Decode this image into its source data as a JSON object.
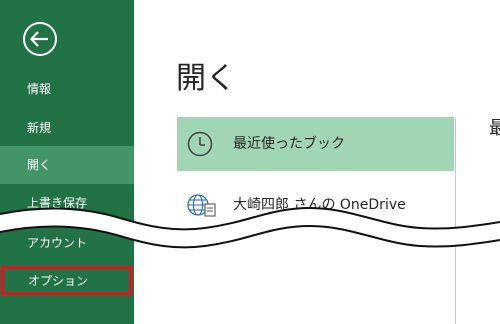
{
  "sidebar": {
    "items": [
      {
        "label": "情報"
      },
      {
        "label": "新規"
      },
      {
        "label": "開く"
      },
      {
        "label": "上書き保存"
      },
      {
        "label": "アカウント"
      },
      {
        "label": "オプション"
      }
    ]
  },
  "main": {
    "title": "開く",
    "locations": [
      {
        "label": "最近使ったブック",
        "icon": "clock-icon"
      },
      {
        "label": "大崎四郎 さんの OneDrive",
        "icon": "globe-icon"
      }
    ],
    "right_peek_text": "最"
  },
  "colors": {
    "sidebar_bg": "#217346",
    "sidebar_active": "#439467",
    "selected_item": "#a0d6b4",
    "highlight_border": "#e0141e"
  }
}
